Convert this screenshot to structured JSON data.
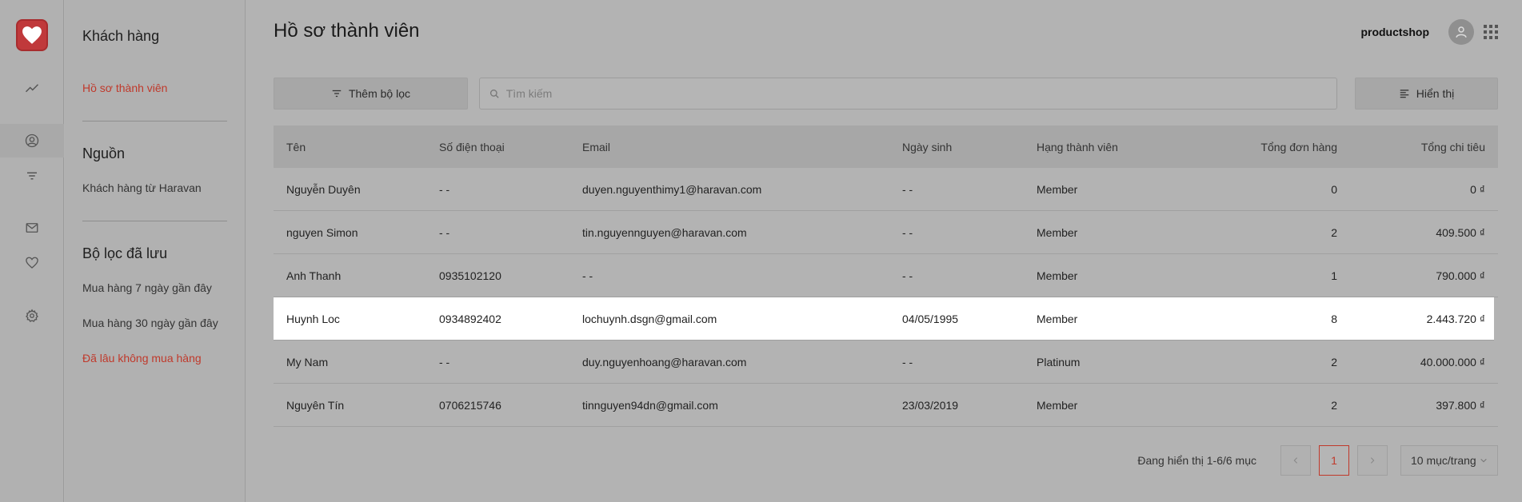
{
  "sidebar": {
    "section1_title": "Khách hàng",
    "item_members": "Hồ sơ thành viên",
    "section2_title": "Nguồn",
    "item_haravan": "Khách hàng từ Haravan",
    "section3_title": "Bộ lọc đã lưu",
    "saved_filters": [
      "Mua hàng 7 ngày gần đây",
      "Mua hàng 30 ngày gần đây",
      "Đã lâu không mua hàng"
    ]
  },
  "header": {
    "title": "Hồ sơ thành viên",
    "shop_name": "productshop"
  },
  "toolbar": {
    "filter_label": "Thêm bộ lọc",
    "search_placeholder": "Tìm kiếm",
    "display_label": "Hiển thị"
  },
  "table": {
    "columns": [
      "Tên",
      "Số điện thoại",
      "Email",
      "Ngày sinh",
      "Hạng thành viên",
      "Tổng đơn hàng",
      "Tổng chi tiêu"
    ],
    "rows": [
      [
        "Nguyễn Duyên",
        "- -",
        "duyen.nguyenthimy1@haravan.com",
        "- -",
        "Member",
        "0",
        "0 ₫"
      ],
      [
        "nguyen Simon",
        "- -",
        "tin.nguyennguyen@haravan.com",
        "- -",
        "Member",
        "2",
        "409.500 ₫"
      ],
      [
        "Anh Thanh",
        "0935102120",
        "- -",
        "- -",
        "Member",
        "1",
        "790.000 ₫"
      ],
      [
        "Huynh Loc",
        "0934892402",
        "lochuynh.dsgn@gmail.com",
        "04/05/1995",
        "Member",
        "8",
        "2.443.720 ₫"
      ],
      [
        "My Nam",
        "- -",
        "duy.nguyenhoang@haravan.com",
        "- -",
        "Platinum",
        "2",
        "40.000.000 ₫"
      ],
      [
        "Nguyên Tín",
        "0706215746",
        "tinnguyen94dn@gmail.com",
        "23/03/2019",
        "Member",
        "2",
        "397.800 ₫"
      ]
    ],
    "highlighted_row": 3
  },
  "pagination": {
    "summary": "Đang hiển thị 1-6/6 mục",
    "current_page": "1",
    "page_size": "10 mục/trang"
  },
  "colors": {
    "accent": "#c0392b",
    "overlay_background": "#b3b3b3"
  }
}
